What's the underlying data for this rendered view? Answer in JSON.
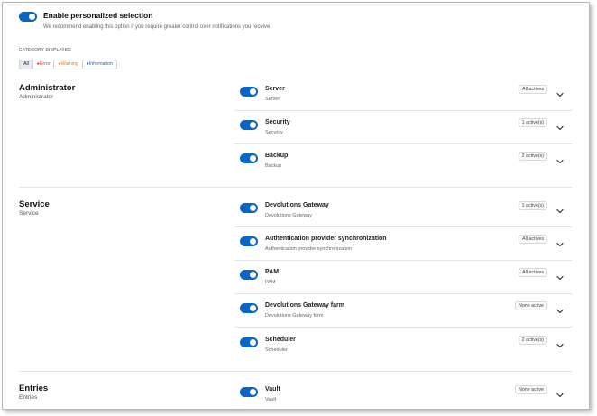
{
  "header": {
    "title": "Enable personalized selection",
    "description": "We recommend enabling this option if you require greater control over notifications you receive",
    "toggle_on": true
  },
  "category": {
    "label": "CATEGORY DISPLAYED",
    "filters": [
      {
        "label": "All",
        "color": "#222222"
      },
      {
        "label": "●Error",
        "color": "#d93025"
      },
      {
        "label": "●Warning",
        "color": "#f57c00"
      },
      {
        "label": "●Information",
        "color": "#1a66c2"
      }
    ]
  },
  "accent_color": "#0a66c2",
  "sections": [
    {
      "title": "Administrator",
      "subtitle": "Administrator",
      "items": [
        {
          "title": "Server",
          "subtitle": "Server",
          "badge": "All actives"
        },
        {
          "title": "Security",
          "subtitle": "Security",
          "badge": "1 active(s)"
        },
        {
          "title": "Backup",
          "subtitle": "Backup",
          "badge": "2 active(s)"
        }
      ]
    },
    {
      "title": "Service",
      "subtitle": "Service",
      "items": [
        {
          "title": "Devolutions Gateway",
          "subtitle": "Devolutions Gateway",
          "badge": "1 active(s)"
        },
        {
          "title": "Authentication provider synchronization",
          "subtitle": "Authentication provider synchronization",
          "badge": "All actives"
        },
        {
          "title": "PAM",
          "subtitle": "PAM",
          "badge": "All actives"
        },
        {
          "title": "Devolutions Gateway farm",
          "subtitle": "Devolutions Gateway farm",
          "badge": "None active"
        },
        {
          "title": "Scheduler",
          "subtitle": "Scheduler",
          "badge": "2 active(s)"
        }
      ]
    },
    {
      "title": "Entries",
      "subtitle": "Entries",
      "items": [
        {
          "title": "Vault",
          "subtitle": "Vault",
          "badge": "None active"
        }
      ]
    }
  ]
}
